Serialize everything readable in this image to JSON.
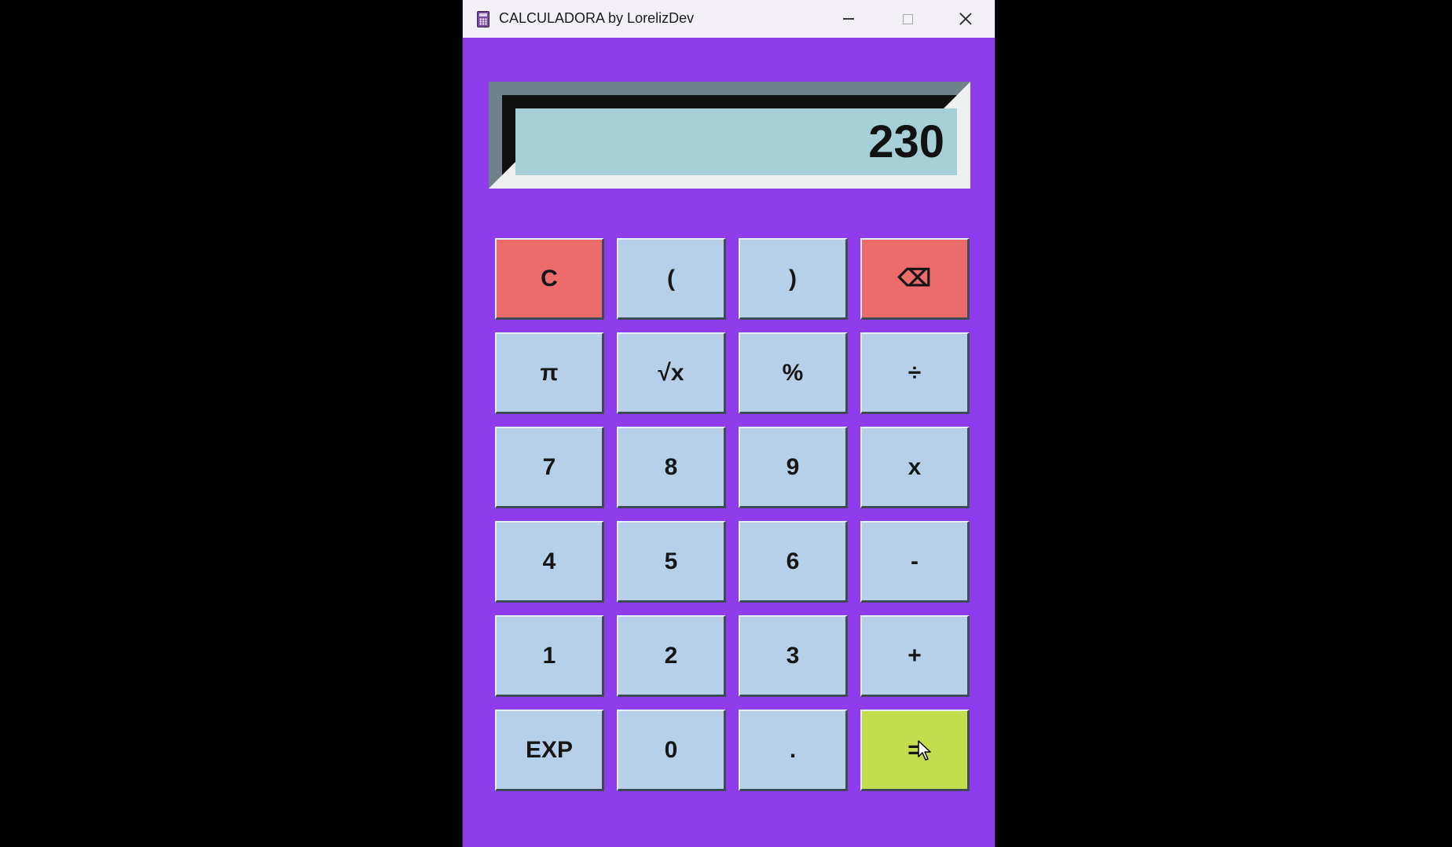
{
  "window": {
    "title": "CALCULADORA by LorelizDev",
    "icon": "calculator-icon",
    "controls": [
      "minimize-icon",
      "maximize-icon",
      "close-icon"
    ]
  },
  "display": {
    "value": "230"
  },
  "colors": {
    "window_background": "#8f3ced",
    "key_default": "#b6d0ea",
    "key_clear": "#ec6b6b",
    "key_equals": "#c4dd4c",
    "display_screen": "#a6cfd6"
  },
  "keys": [
    {
      "label": "C",
      "name": "clear-button",
      "style": "red"
    },
    {
      "label": "(",
      "name": "open-paren-button",
      "style": "default"
    },
    {
      "label": ")",
      "name": "close-paren-button",
      "style": "default"
    },
    {
      "label": "⌫",
      "name": "backspace-button",
      "style": "red"
    },
    {
      "label": "π",
      "name": "pi-button",
      "style": "default"
    },
    {
      "label": "√x",
      "name": "sqrt-button",
      "style": "default"
    },
    {
      "label": "%",
      "name": "percent-button",
      "style": "default"
    },
    {
      "label": "÷",
      "name": "divide-button",
      "style": "default"
    },
    {
      "label": "7",
      "name": "digit-7-button",
      "style": "default"
    },
    {
      "label": "8",
      "name": "digit-8-button",
      "style": "default"
    },
    {
      "label": "9",
      "name": "digit-9-button",
      "style": "default"
    },
    {
      "label": "x",
      "name": "multiply-button",
      "style": "default"
    },
    {
      "label": "4",
      "name": "digit-4-button",
      "style": "default"
    },
    {
      "label": "5",
      "name": "digit-5-button",
      "style": "default"
    },
    {
      "label": "6",
      "name": "digit-6-button",
      "style": "default"
    },
    {
      "label": "-",
      "name": "subtract-button",
      "style": "default"
    },
    {
      "label": "1",
      "name": "digit-1-button",
      "style": "default"
    },
    {
      "label": "2",
      "name": "digit-2-button",
      "style": "default"
    },
    {
      "label": "3",
      "name": "digit-3-button",
      "style": "default"
    },
    {
      "label": "+",
      "name": "add-button",
      "style": "default"
    },
    {
      "label": "EXP",
      "name": "exp-button",
      "style": "default"
    },
    {
      "label": "0",
      "name": "digit-0-button",
      "style": "default"
    },
    {
      "label": ".",
      "name": "decimal-button",
      "style": "default"
    },
    {
      "label": "=",
      "name": "equals-button",
      "style": "green"
    }
  ]
}
